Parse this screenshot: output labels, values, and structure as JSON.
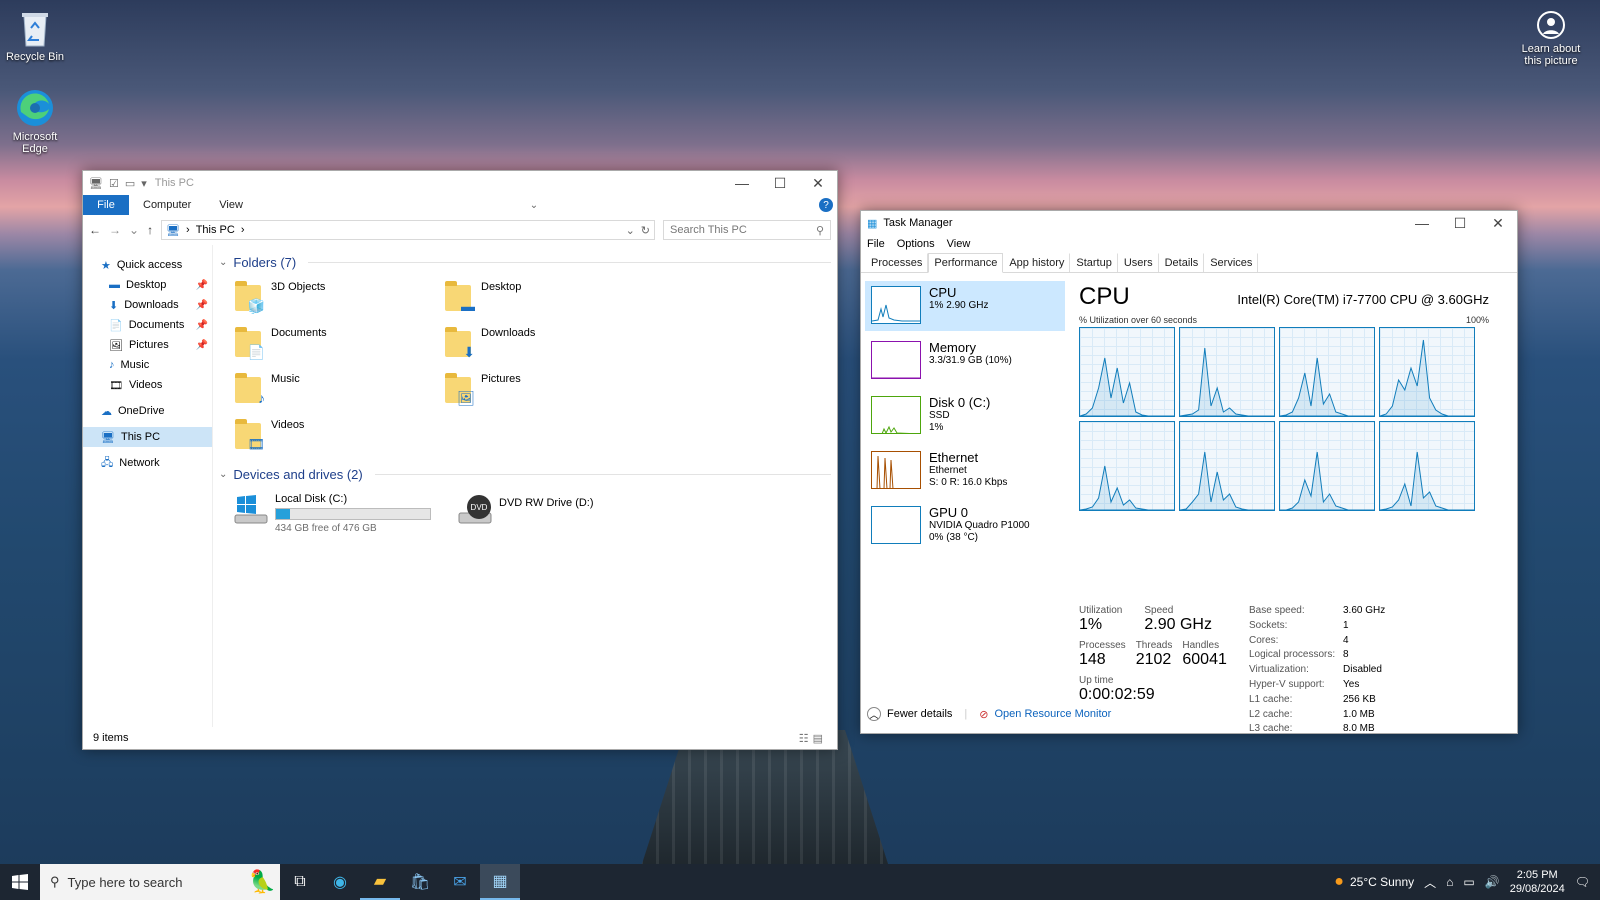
{
  "desktop": {
    "icons": [
      {
        "label": "Recycle Bin",
        "icon": "recycle-bin-icon"
      },
      {
        "label": "Microsoft Edge",
        "icon": "edge-icon"
      }
    ],
    "learn": {
      "label": "Learn about this picture",
      "icon": "camera-icon"
    }
  },
  "explorer": {
    "title": "This PC",
    "ribbon": {
      "file": "File",
      "tabs": [
        "Computer",
        "View"
      ],
      "help": "?"
    },
    "address": "This PC",
    "search_placeholder": "Search This PC",
    "nav": {
      "quick_access": "Quick access",
      "quick_items": [
        "Desktop",
        "Downloads",
        "Documents",
        "Pictures",
        "Music",
        "Videos"
      ],
      "onedrive": "OneDrive",
      "this_pc": "This PC",
      "network": "Network"
    },
    "folders_header": "Folders (7)",
    "folders": [
      "3D Objects",
      "Desktop",
      "Documents",
      "Downloads",
      "Music",
      "Pictures",
      "Videos"
    ],
    "devices_header": "Devices and drives (2)",
    "drives": [
      {
        "name": "Local Disk (C:)",
        "free": "434 GB free of 476 GB",
        "used_fraction": 0.088
      },
      {
        "name": "DVD RW Drive (D:)",
        "badge": "DVD"
      }
    ],
    "status": "9 items"
  },
  "taskmgr": {
    "title": "Task Manager",
    "menu": [
      "File",
      "Options",
      "View"
    ],
    "tabs": [
      "Processes",
      "Performance",
      "App history",
      "Startup",
      "Users",
      "Details",
      "Services"
    ],
    "active_tab": "Performance",
    "resources": [
      {
        "name": "CPU",
        "lines": [
          "1% 2.90 GHz"
        ],
        "color": "#117dbb"
      },
      {
        "name": "Memory",
        "lines": [
          "3.3/31.9 GB (10%)"
        ],
        "color": "#8b12ae"
      },
      {
        "name": "Disk 0 (C:)",
        "lines": [
          "SSD",
          "1%"
        ],
        "color": "#4da60c"
      },
      {
        "name": "Ethernet",
        "lines": [
          "Ethernet",
          "S: 0 R: 16.0 Kbps"
        ],
        "color": "#a74f01"
      },
      {
        "name": "GPU 0",
        "lines": [
          "NVIDIA Quadro P1000",
          "0% (38 °C)"
        ],
        "color": "#117dbb"
      }
    ],
    "cpu": {
      "heading": "CPU",
      "model": "Intel(R) Core(TM) i7-7700 CPU @ 3.60GHz",
      "graph_label": "% Utilization over 60 seconds",
      "graph_max": "100%",
      "utilization_label": "Utilization",
      "utilization": "1%",
      "speed_label": "Speed",
      "speed": "2.90 GHz",
      "processes_label": "Processes",
      "processes": "148",
      "threads_label": "Threads",
      "threads": "2102",
      "handles_label": "Handles",
      "handles": "60041",
      "uptime_label": "Up time",
      "uptime": "0:00:02:59",
      "specs": [
        [
          "Base speed:",
          "3.60 GHz"
        ],
        [
          "Sockets:",
          "1"
        ],
        [
          "Cores:",
          "4"
        ],
        [
          "Logical processors:",
          "8"
        ],
        [
          "Virtualization:",
          "Disabled"
        ],
        [
          "Hyper-V support:",
          "Yes"
        ],
        [
          "L1 cache:",
          "256 KB"
        ],
        [
          "L2 cache:",
          "1.0 MB"
        ],
        [
          "L3 cache:",
          "8.0 MB"
        ]
      ]
    },
    "fewer_details": "Fewer details",
    "resource_monitor": "Open Resource Monitor"
  },
  "taskbar": {
    "search_placeholder": "Type here to search",
    "weather": "25°C  Sunny",
    "time": "2:05 PM",
    "date": "29/08/2024"
  }
}
